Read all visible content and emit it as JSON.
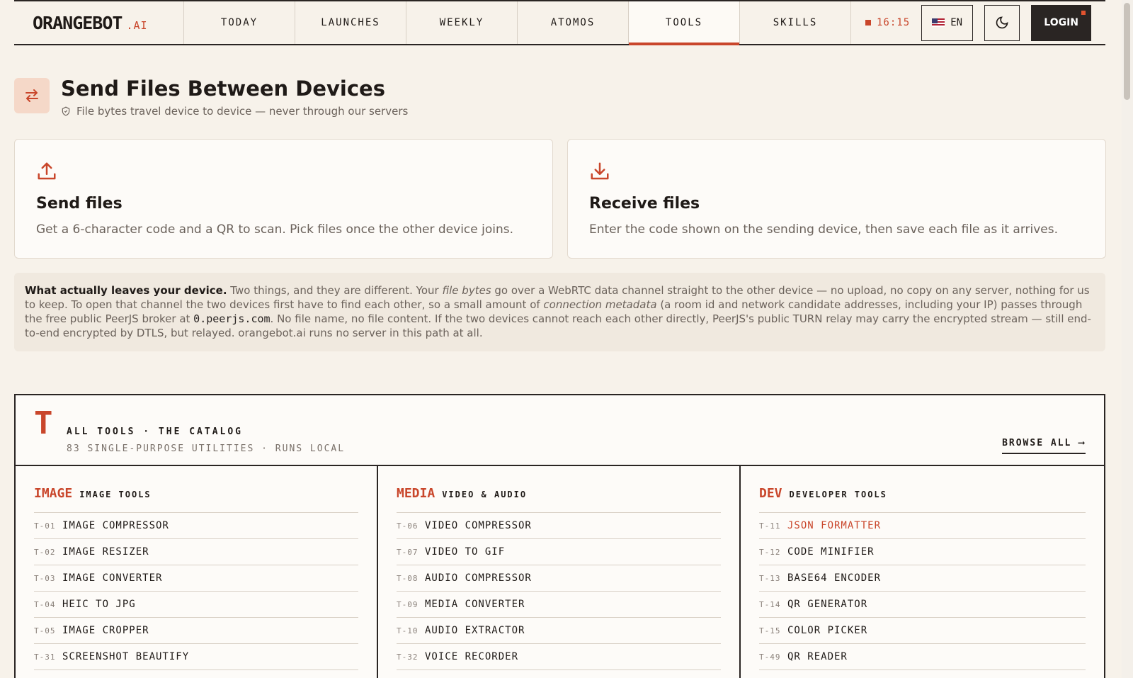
{
  "nav": {
    "brand": "ORANGEBOT",
    "brand_suffix": ".AI",
    "tabs": [
      {
        "label": "TODAY"
      },
      {
        "label": "LAUNCHES"
      },
      {
        "label": "WEEKLY"
      },
      {
        "label": "ATOMOS"
      },
      {
        "label": "TOOLS",
        "active": true
      },
      {
        "label": "SKILLS"
      }
    ],
    "clock": "16:15",
    "lang": "EN",
    "login": "LOGIN"
  },
  "header": {
    "title": "Send Files Between Devices",
    "subtitle": "File bytes travel device to device — never through our servers"
  },
  "cards": {
    "send": {
      "title": "Send files",
      "desc": "Get a 6-character code and a QR to scan. Pick files once the other device joins."
    },
    "receive": {
      "title": "Receive files",
      "desc": "Enter the code shown on the sending device, then save each file as it arrives."
    }
  },
  "info": {
    "lead": "What actually leaves your device.",
    "p1": " Two things, and they are different. Your ",
    "em1": "file bytes",
    "p2": " go over a WebRTC data channel straight to the other device — no upload, no copy on any server, nothing for us to keep. To open that channel the two devices first have to find each other, so a small amount of ",
    "em2": "connection metadata",
    "p3": " (a room id and network candidate addresses, including your IP) passes through the free public PeerJS broker at ",
    "code": "0.peerjs.com",
    "p4": ". No file name, no file content. If the two devices cannot reach each other directly, PeerJS's public TURN relay may carry the encrypted stream — still end-to-end encrypted by DTLS, but relayed. orangebot.ai runs no server in this path at all."
  },
  "catalog": {
    "letter": "T",
    "title": "ALL TOOLS · THE CATALOG",
    "subtitle": "83 SINGLE-PURPOSE UTILITIES · RUNS LOCAL",
    "browse": "BROWSE ALL ⟶",
    "columns": [
      {
        "code": "IMAGE",
        "name": "IMAGE TOOLS",
        "tools": [
          {
            "id": "T-01",
            "name": "IMAGE COMPRESSOR"
          },
          {
            "id": "T-02",
            "name": "IMAGE RESIZER"
          },
          {
            "id": "T-03",
            "name": "IMAGE CONVERTER"
          },
          {
            "id": "T-04",
            "name": "HEIC TO JPG"
          },
          {
            "id": "T-05",
            "name": "IMAGE CROPPER"
          },
          {
            "id": "T-31",
            "name": "SCREENSHOT BEAUTIFY"
          }
        ]
      },
      {
        "code": "MEDIA",
        "name": "VIDEO & AUDIO",
        "tools": [
          {
            "id": "T-06",
            "name": "VIDEO COMPRESSOR"
          },
          {
            "id": "T-07",
            "name": "VIDEO TO GIF"
          },
          {
            "id": "T-08",
            "name": "AUDIO COMPRESSOR"
          },
          {
            "id": "T-09",
            "name": "MEDIA CONVERTER"
          },
          {
            "id": "T-10",
            "name": "AUDIO EXTRACTOR"
          },
          {
            "id": "T-32",
            "name": "VOICE RECORDER"
          }
        ]
      },
      {
        "code": "DEV",
        "name": "DEVELOPER TOOLS",
        "tools": [
          {
            "id": "T-11",
            "name": "JSON FORMATTER",
            "highlight": true
          },
          {
            "id": "T-12",
            "name": "CODE MINIFIER"
          },
          {
            "id": "T-13",
            "name": "BASE64 ENCODER"
          },
          {
            "id": "T-14",
            "name": "QR GENERATOR"
          },
          {
            "id": "T-15",
            "name": "COLOR PICKER"
          },
          {
            "id": "T-49",
            "name": "QR READER"
          }
        ]
      }
    ]
  },
  "colors": {
    "accent": "#c9462b",
    "background": "#f7f2ea",
    "ink": "#2a2523"
  }
}
